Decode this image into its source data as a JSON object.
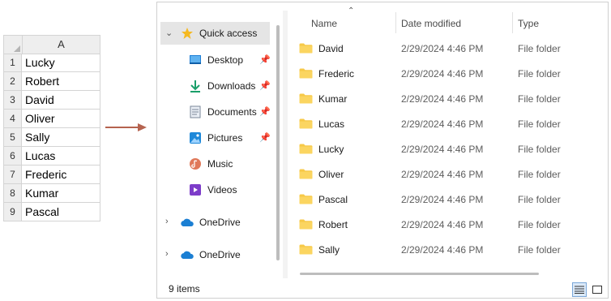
{
  "spreadsheet": {
    "column_header": "A",
    "rows": [
      {
        "num": "1",
        "value": "Lucky"
      },
      {
        "num": "2",
        "value": "Robert"
      },
      {
        "num": "3",
        "value": "David"
      },
      {
        "num": "4",
        "value": "Oliver"
      },
      {
        "num": "5",
        "value": "Sally"
      },
      {
        "num": "6",
        "value": "Lucas"
      },
      {
        "num": "7",
        "value": "Frederic"
      },
      {
        "num": "8",
        "value": "Kumar"
      },
      {
        "num": "9",
        "value": "Pascal"
      }
    ]
  },
  "arrow_color": "#b5634f",
  "explorer": {
    "nav": {
      "quick_access": "Quick access",
      "items": [
        {
          "label": "Desktop",
          "icon": "desktop-icon"
        },
        {
          "label": "Downloads",
          "icon": "downloads-icon"
        },
        {
          "label": "Documents",
          "icon": "documents-icon"
        },
        {
          "label": "Pictures",
          "icon": "pictures-icon"
        },
        {
          "label": "Music",
          "icon": "music-icon"
        },
        {
          "label": "Videos",
          "icon": "videos-icon"
        }
      ],
      "onedrive": [
        "OneDrive",
        "OneDrive"
      ]
    },
    "columns": {
      "name": "Name",
      "date": "Date modified",
      "type": "Type"
    },
    "files": [
      {
        "name": "David",
        "date": "2/29/2024 4:46 PM",
        "type": "File folder"
      },
      {
        "name": "Frederic",
        "date": "2/29/2024 4:46 PM",
        "type": "File folder"
      },
      {
        "name": "Kumar",
        "date": "2/29/2024 4:46 PM",
        "type": "File folder"
      },
      {
        "name": "Lucas",
        "date": "2/29/2024 4:46 PM",
        "type": "File folder"
      },
      {
        "name": "Lucky",
        "date": "2/29/2024 4:46 PM",
        "type": "File folder"
      },
      {
        "name": "Oliver",
        "date": "2/29/2024 4:46 PM",
        "type": "File folder"
      },
      {
        "name": "Pascal",
        "date": "2/29/2024 4:46 PM",
        "type": "File folder"
      },
      {
        "name": "Robert",
        "date": "2/29/2024 4:46 PM",
        "type": "File folder"
      },
      {
        "name": "Sally",
        "date": "2/29/2024 4:46 PM",
        "type": "File folder"
      }
    ],
    "status": "9 items"
  }
}
